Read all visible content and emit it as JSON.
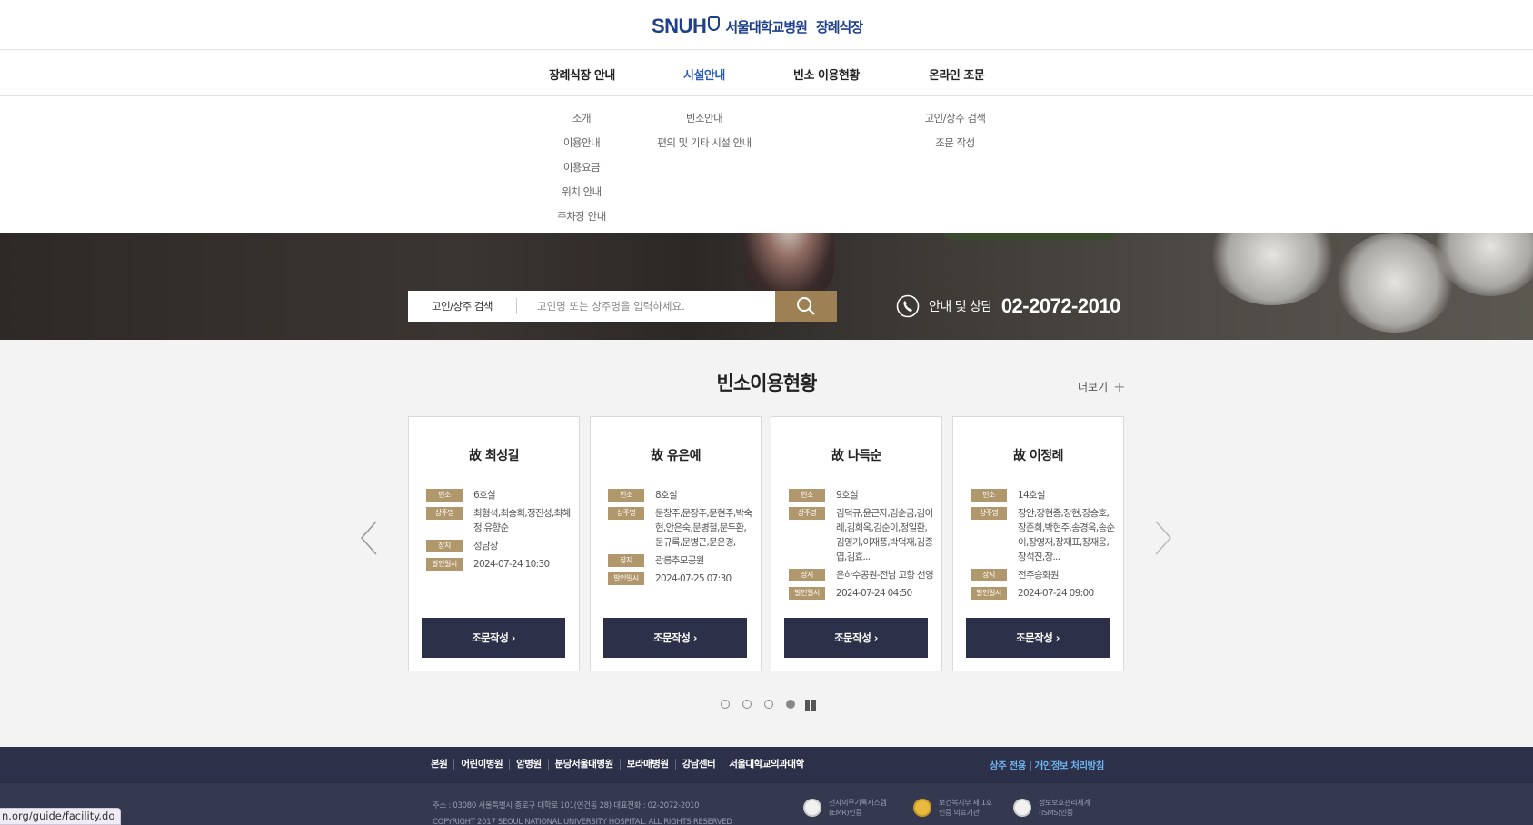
{
  "header": {
    "logo_text": "SNUH",
    "hospital_name": "서울대학교병원",
    "site_name": "장례식장"
  },
  "gnb": {
    "items": [
      {
        "label": "장례식장 안내",
        "active": false
      },
      {
        "label": "시설안내",
        "active": true
      },
      {
        "label": "빈소 이용현황",
        "active": false
      },
      {
        "label": "온라인 조문",
        "active": false
      }
    ],
    "submenus": [
      [
        "소개",
        "이용안내",
        "이용요금",
        "위치 안내",
        "주차장 안내"
      ],
      [
        "빈소안내",
        "편의 및 기타 시설 안내"
      ],
      [],
      [
        "고인/상주 검색",
        "조문 작성"
      ]
    ]
  },
  "hero": {
    "search_label": "고인/상주 검색",
    "search_placeholder": "고인명 또는 상주명을 입력하세요.",
    "search_value": "",
    "search_button_icon": "search-icon",
    "phone_icon": "phone-icon",
    "phone_label": "안내 및 상담",
    "phone_number": "02-2072-2010"
  },
  "section": {
    "title": "빈소이용현황",
    "more_label": "더보기",
    "labels": {
      "room": "빈소",
      "mourner": "상주명",
      "burial": "장지",
      "departure": "발인일시"
    },
    "cards": [
      {
        "name": "故 최성길",
        "room": "6호실",
        "mourner": "최형석,최승희,정진성,최혜정,유향순",
        "burial": "성남장",
        "departure": "2024-07-24 10:30",
        "button": "조문작성 ›"
      },
      {
        "name": "故 유은예",
        "room": "8호실",
        "mourner": "문창주,문장주,문현주,박숙현,안은숙,문병철,문두환,문규록,문병근,문은경,",
        "burial": "광릉추모공원",
        "departure": "2024-07-25 07:30",
        "button": "조문작성 ›"
      },
      {
        "name": "故 나득순",
        "room": "9호실",
        "mourner": "김덕규,윤근자,김순금,김이례,김희옥,김순이,정일환,김영기,이재풍,박덕재,김종엽,김효...",
        "burial": "은하수공원-전남 고향 선영",
        "departure": "2024-07-24 04:50",
        "button": "조문작성 ›"
      },
      {
        "name": "故 이정례",
        "room": "14호실",
        "mourner": "장안,장현종,장현,장승호,장준희,박현주,송경옥,송순이,장영재,장재표,장재웅,장석진,장...",
        "burial": "전주승화원",
        "departure": "2024-07-24 09:00",
        "button": "조문작성 ›"
      }
    ],
    "pager": {
      "count": 4,
      "current": 4,
      "pause_icon": "pause-icon"
    }
  },
  "footer": {
    "links": [
      "본원",
      "어린이병원",
      "암병원",
      "분당서울대병원",
      "보라매병원",
      "강남센터",
      "서울대학교의과대학"
    ],
    "right_links": "상주 전용 | 개인정보 처리방침",
    "address": "주소 : 03080 서울특별시 종로구 대학로 101(연건동 28)   대표전화 : 02-2072-2010",
    "copyright": "COPYRIGHT 2017 SEOUL NATIONAL UNIVERSITY HOSPITAL. ALL RIGHTS RESERVED",
    "certs": [
      {
        "line1": "전자의무기록시스템",
        "line2": "(EMR)인증"
      },
      {
        "line1": "보건복지부 제 1호",
        "line2": "인증 의료기관"
      },
      {
        "line1": "정보보호관리체계",
        "line2": "(ISMS)인증"
      }
    ]
  },
  "status_url": "n.org/guide/facility.do"
}
